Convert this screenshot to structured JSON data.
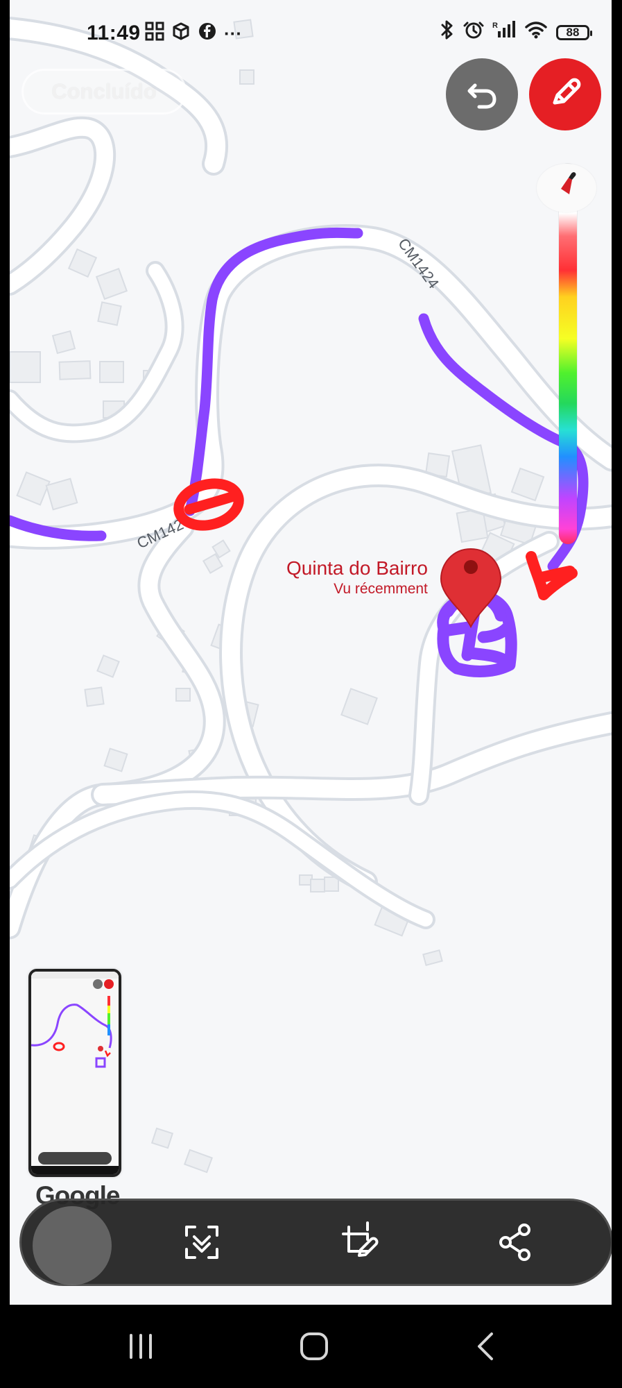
{
  "status_bar": {
    "time": "11:49",
    "dots": "···",
    "battery": "88"
  },
  "top_controls": {
    "done_label": "Concluído"
  },
  "map": {
    "roads": [
      "CM1424",
      "CM1424"
    ],
    "place_name": "Quinta do Bairro",
    "place_subtitle": "Vu récemment",
    "google_logo": "Google"
  },
  "toolbar": {
    "items": [
      "scan-icon",
      "edit-crop-icon",
      "share-icon"
    ]
  },
  "navigation": {
    "items": [
      "recent-apps",
      "home",
      "back"
    ]
  }
}
